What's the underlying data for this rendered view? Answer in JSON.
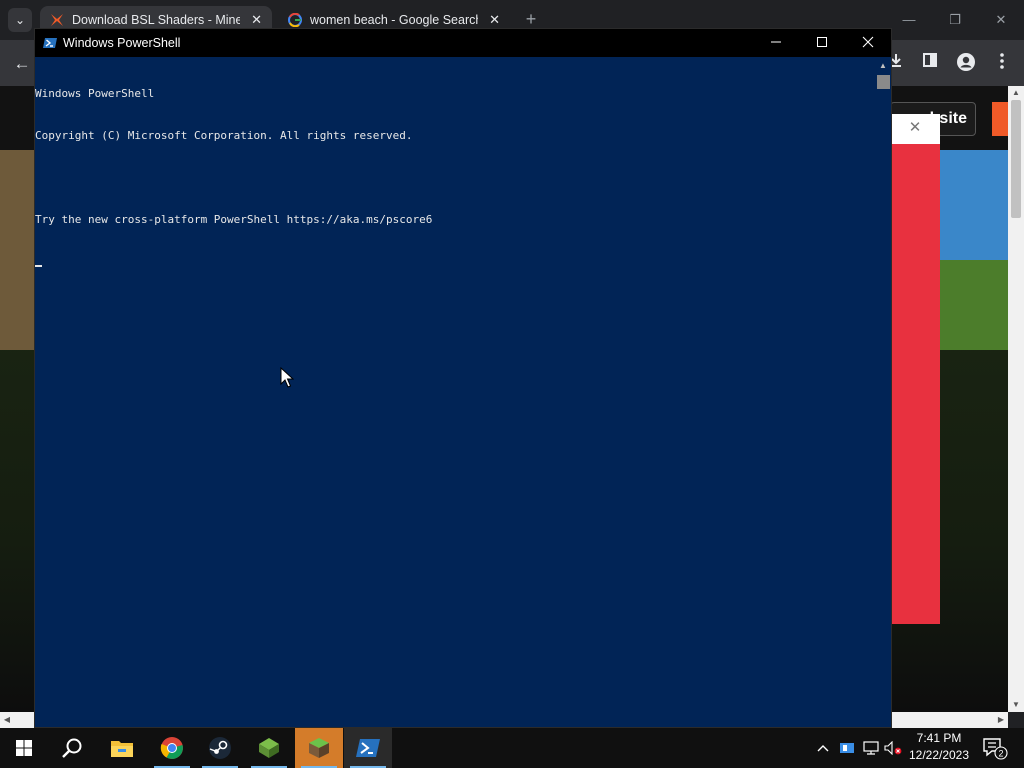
{
  "browser": {
    "tabs": [
      {
        "title": "Download BSL Shaders - Minec",
        "close": "✕",
        "favicon": "bsl-favicon-icon"
      },
      {
        "title": "women beach - Google Search",
        "close": "✕",
        "favicon": "google-g-icon"
      }
    ],
    "new_tab": "+",
    "tab_search": "⌄",
    "window_controls": {
      "minimize": "—",
      "restore": "❐",
      "close": "✕"
    },
    "back": "←",
    "webpage": {
      "header_button": "bsite",
      "popup_close": "✕"
    }
  },
  "powershell": {
    "title": "Windows PowerShell",
    "controls": {
      "minimize": "—",
      "maximize": "☐",
      "close": "✕"
    },
    "lines": [
      "Windows PowerShell",
      "Copyright (C) Microsoft Corporation. All rights reserved.",
      "",
      "Try the new cross-platform PowerShell https://aka.ms/pscore6",
      ""
    ],
    "colors": {
      "background": "#012456",
      "text": "#e8e8e8"
    }
  },
  "taskbar": {
    "apps": [
      "start-icon",
      "search-icon",
      "file-explorer-icon",
      "chrome-icon",
      "steam-icon",
      "minecraft-launcher-icon",
      "minecraft-icon",
      "powershell-icon"
    ],
    "clock": {
      "time": "7:41 PM",
      "date": "12/22/2023"
    },
    "notification_count": "2"
  }
}
